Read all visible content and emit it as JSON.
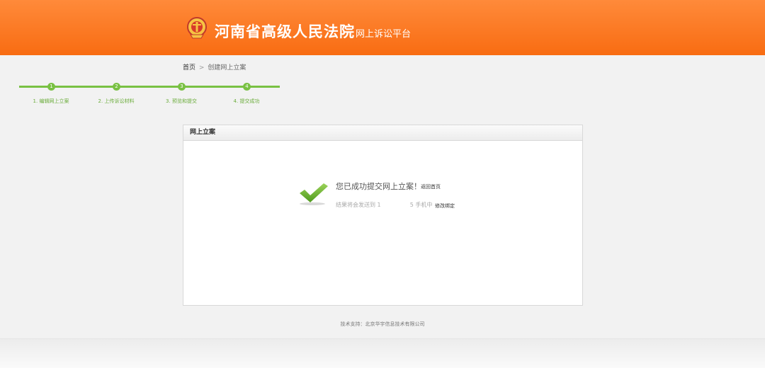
{
  "header": {
    "title": "河南省高级人民法院",
    "subtitle": "网上诉讼平台",
    "emblem_icon": "court-emblem-icon"
  },
  "breadcrumb": {
    "home": "首页",
    "separator": ">",
    "current": "创建网上立案"
  },
  "steps": [
    {
      "number": "1",
      "label": "1. 编辑网上立案"
    },
    {
      "number": "2",
      "label": "2. 上传诉讼材料"
    },
    {
      "number": "3",
      "label": "3. 预览和提交"
    },
    {
      "number": "4",
      "label": "4. 提交成功"
    }
  ],
  "panel": {
    "title": "网上立案",
    "success_message": "您已成功提交网上立案！",
    "back_home_link": "返回首页",
    "result_prefix": "结果将会发送到",
    "phone_start": "1",
    "phone_end": "5",
    "result_suffix": "手机中",
    "modify_binding_link": "修改绑定"
  },
  "footer": {
    "text": "技术支持：北京华宇信息技术有限公司"
  },
  "colors": {
    "header_orange": "#f87a24",
    "progress_green": "#79c143",
    "check_green": "#6cb52c"
  }
}
